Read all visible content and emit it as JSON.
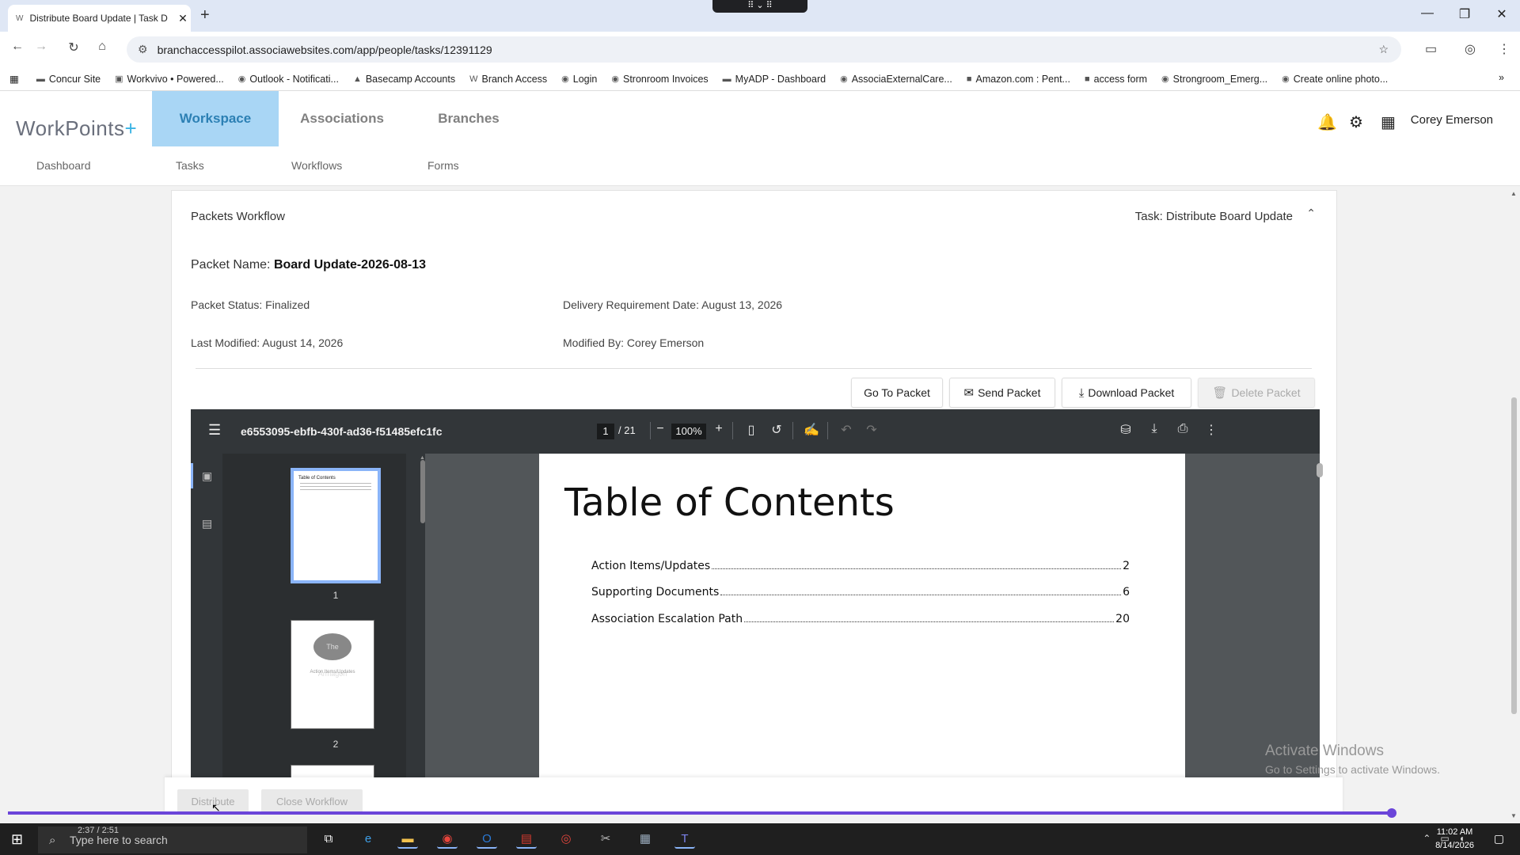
{
  "browser": {
    "tab_title": "Distribute Board Update | Task D",
    "tab_favicon": "W",
    "url": "branchaccesspilot.associawebsites.com/app/people/tasks/12391129",
    "bookmarks": [
      {
        "label": "Concur Site",
        "icon": "▬"
      },
      {
        "label": "Workvivo • Powered...",
        "icon": "▣"
      },
      {
        "label": "Outlook - Notificati...",
        "icon": "◉"
      },
      {
        "label": "Basecamp Accounts",
        "icon": "▲"
      },
      {
        "label": "Branch Access",
        "icon": "W"
      },
      {
        "label": "Login",
        "icon": "◉"
      },
      {
        "label": "Stronroom Invoices",
        "icon": "◉"
      },
      {
        "label": "MyADP - Dashboard",
        "icon": "▬"
      },
      {
        "label": "AssociaExternalCare...",
        "icon": "◉"
      },
      {
        "label": "Amazon.com : Pent...",
        "icon": "■"
      },
      {
        "label": "access form",
        "icon": "■"
      },
      {
        "label": "Strongroom_Emerg...",
        "icon": "◉"
      },
      {
        "label": "Create online photo...",
        "icon": "◉"
      }
    ]
  },
  "app": {
    "logo_text": "WorkPoints",
    "logo_plus": "+",
    "nav": [
      "Workspace",
      "Associations",
      "Branches"
    ],
    "subnav": [
      "Dashboard",
      "Tasks",
      "Workflows",
      "Forms"
    ],
    "user": "Corey Emerson"
  },
  "packet": {
    "workflow": "Packets Workflow",
    "task": "Task: Distribute Board Update",
    "name_label": "Packet Name:",
    "name": "Board Update-2026-08-13",
    "status": "Packet Status: Finalized",
    "delivery": "Delivery Requirement Date: August 13, 2026",
    "last_modified": "Last Modified: August 14, 2026",
    "modified_by": "Modified By: Corey Emerson",
    "buttons": {
      "go_to": "Go To Packet",
      "send": "Send Packet",
      "download": "Download Packet",
      "delete": "Delete Packet"
    }
  },
  "pdf": {
    "filename": "e6553095-ebfb-430f-ad36-f51485efc1fc",
    "page": "1",
    "total": "/ 21",
    "zoom": "100%",
    "thumbs": [
      {
        "label": "1",
        "title": "Table of Contents"
      },
      {
        "label": "2",
        "logo": "The Armagon",
        "sub": "Action Items/Updates"
      }
    ],
    "toc_title": "Table of Contents",
    "toc": [
      {
        "label": "Action Items/Updates",
        "page": "2"
      },
      {
        "label": "Supporting Documents",
        "page": "6"
      },
      {
        "label": "Association Escalation Path",
        "page": "20"
      }
    ]
  },
  "footer": {
    "distribute": "Distribute",
    "close": "Close Workflow"
  },
  "watermark": {
    "line1": "Activate Windows",
    "line2": "Go to Settings to activate Windows."
  },
  "media": {
    "time": "2:37 / 2:51",
    "progress": 0.999
  },
  "taskbar": {
    "search_placeholder": "Type here to search",
    "time": "11:02 AM",
    "date": "8/14/2026"
  },
  "colors": {
    "accent": "#a9d6f5",
    "nav_active_text": "#2c80b4",
    "media": "#6b45d9"
  }
}
